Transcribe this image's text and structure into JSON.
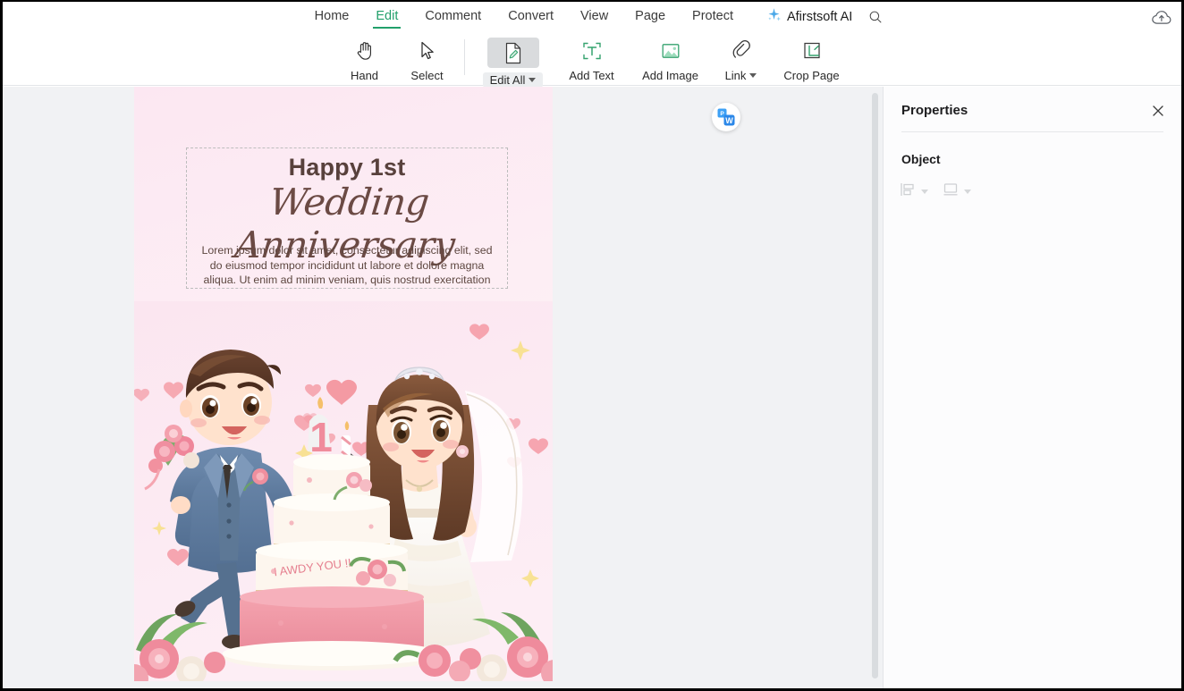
{
  "menu": {
    "tabs": [
      {
        "label": "Home",
        "active": false
      },
      {
        "label": "Edit",
        "active": true
      },
      {
        "label": "Comment",
        "active": false
      },
      {
        "label": "Convert",
        "active": false
      },
      {
        "label": "View",
        "active": false
      },
      {
        "label": "Page",
        "active": false
      },
      {
        "label": "Protect",
        "active": false
      }
    ],
    "ai_label": "Afirstsoft AI",
    "search_icon": "search-icon",
    "sparkle_icon": "sparkle-icon",
    "cloud_icon": "cloud-upload-icon"
  },
  "toolbar": {
    "items": [
      {
        "label": "Hand",
        "icon": "hand-icon",
        "selected": false,
        "dropdown": false
      },
      {
        "label": "Select",
        "icon": "cursor-arrow-icon",
        "selected": false,
        "dropdown": false
      },
      {
        "label": "Edit All",
        "icon": "edit-document-icon",
        "selected": true,
        "dropdown": true
      },
      {
        "label": "Add Text",
        "icon": "add-text-icon",
        "selected": false,
        "dropdown": false
      },
      {
        "label": "Add Image",
        "icon": "add-image-icon",
        "selected": false,
        "dropdown": false
      },
      {
        "label": "Link",
        "icon": "link-icon",
        "selected": false,
        "dropdown": true
      },
      {
        "label": "Crop Page",
        "icon": "crop-page-icon",
        "selected": false,
        "dropdown": false
      }
    ]
  },
  "document": {
    "title_line1": "Happy 1st",
    "title_line2": "Wedding Anniversary",
    "body": "Lorem ipsum dolor sit amet, consectetur adipiscing elit, sed do eiusmod tempor incididunt ut labore et dolore magna aliqua. Ut enim ad minim veniam, quis nostrud exercitation",
    "cake_text": "I AWDY YOU !!",
    "cake_number": "1",
    "convert_button_icon": "pdf-to-word-icon"
  },
  "properties": {
    "title": "Properties",
    "close_icon": "close-icon",
    "section_label": "Object",
    "tools": [
      {
        "icon": "align-objects-icon",
        "label": ""
      },
      {
        "icon": "arrange-objects-icon",
        "label": ""
      }
    ]
  },
  "colors": {
    "accent_green": "#22a06b",
    "canvas_bg": "#f1f2f4",
    "page_bg": "#fce7f2",
    "text_dark": "#1d1d1f",
    "title_brown": "#58413c"
  }
}
